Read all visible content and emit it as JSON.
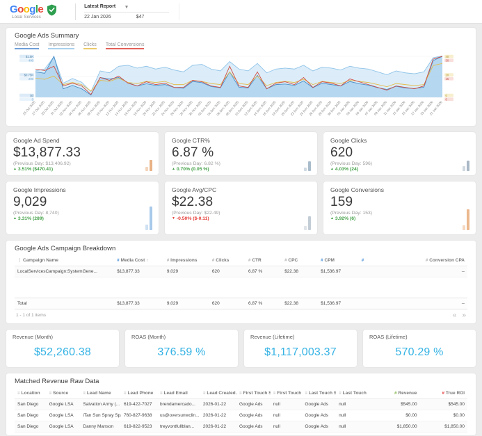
{
  "icons": {
    "caret_down": "▾",
    "check": "✓",
    "sort_up": "↑",
    "sort_down": "↓",
    "hash": "#",
    "menu": "⋮",
    "filter": "≡",
    "prev": "«",
    "next": "»",
    "up": "▲",
    "down": "▼"
  },
  "colors": {
    "accent_cyan": "#35b3e4",
    "green": "#43a047",
    "red": "#e53935"
  },
  "header": {
    "logo_letters": [
      {
        "ch": "G",
        "c": "#4285F4"
      },
      {
        "ch": "o",
        "c": "#EA4335"
      },
      {
        "ch": "o",
        "c": "#FBBC05"
      },
      {
        "ch": "g",
        "c": "#4285F4"
      },
      {
        "ch": "l",
        "c": "#34A853"
      },
      {
        "ch": "e",
        "c": "#EA4335"
      }
    ],
    "logo_subtext": "Local Services",
    "report_selector": {
      "label": "Latest Report",
      "date": "22 Jan 2026",
      "value": "$47"
    }
  },
  "ads_summary": {
    "title": "Google Ads Summary",
    "legend": [
      {
        "label": "Media Cost",
        "color": "#6f9fd8"
      },
      {
        "label": "Impressions",
        "color": "#a9d0ee"
      },
      {
        "label": "Clicks",
        "color": "#ecca6a"
      },
      {
        "label": "Total Conversions",
        "color": "#e2625a"
      }
    ]
  },
  "chart_data": {
    "type": "area",
    "x": [
      "25 Oct 2025",
      "27 Oct 2025",
      "29 Oct 2025",
      "31 Oct 2025",
      "02 Nov 2025",
      "04 Nov 2025",
      "06 Nov 2025",
      "08 Nov 2025",
      "10 Nov 2025",
      "12 Nov 2025",
      "14 Nov 2025",
      "16 Nov 2025",
      "18 Nov 2025",
      "20 Nov 2025",
      "22 Nov 2025",
      "24 Nov 2025",
      "26 Nov 2025",
      "28 Nov 2025",
      "30 Nov 2025",
      "02 Dec 2025",
      "04 Dec 2025",
      "06 Dec 2025",
      "08 Dec 2025",
      "10 Dec 2025",
      "12 Dec 2025",
      "14 Dec 2025",
      "16 Dec 2025",
      "18 Dec 2025",
      "20 Dec 2025",
      "22 Dec 2025",
      "24 Dec 2025",
      "26 Dec 2025",
      "28 Dec 2025",
      "30 Dec 2025",
      "01 Jan 2026",
      "03 Jan 2026",
      "05 Jan 2026",
      "07 Jan 2026",
      "09 Jan 2026",
      "11 Jan 2026",
      "13 Jan 2026",
      "15 Jan 2026",
      "17 Jan 2026",
      "19 Jan 2026",
      "21 Jan 2026"
    ],
    "series": [
      {
        "name": "Impressions",
        "color": "#8fc3e8",
        "fill": "#d6eaf8",
        "max": 450,
        "values": [
          280,
          300,
          430,
          150,
          200,
          160,
          60,
          280,
          260,
          330,
          340,
          310,
          330,
          300,
          320,
          290,
          270,
          340,
          350,
          300,
          280,
          380,
          300,
          280,
          360,
          260,
          300,
          310,
          300,
          340,
          280,
          320,
          310,
          290,
          330,
          310,
          300,
          270,
          240,
          280,
          260,
          250,
          270,
          420,
          440
        ]
      },
      {
        "name": "Media Cost",
        "color": "#4a90c9",
        "fill": "#aed2ee",
        "max": 1500,
        "values": [
          900,
          850,
          1450,
          300,
          420,
          300,
          80,
          700,
          650,
          700,
          520,
          400,
          480,
          420,
          450,
          350,
          320,
          560,
          520,
          380,
          340,
          900,
          360,
          330,
          780,
          300,
          450,
          470,
          420,
          580,
          340,
          500,
          450,
          400,
          560,
          480,
          430,
          340,
          280,
          390,
          330,
          310,
          360,
          1300,
          1450
        ]
      },
      {
        "name": "Clicks",
        "color": "#e3bd4f",
        "max": 40,
        "values": [
          18,
          17,
          20,
          12,
          14,
          12,
          6,
          16,
          15,
          18,
          14,
          13,
          15,
          14,
          15,
          12,
          12,
          16,
          15,
          13,
          12,
          24,
          13,
          12,
          20,
          11,
          14,
          15,
          14,
          17,
          12,
          15,
          14,
          13,
          16,
          15,
          14,
          12,
          10,
          13,
          12,
          11,
          12,
          30,
          32
        ]
      },
      {
        "name": "Total Conversions",
        "color": "#cf4f45",
        "max": 30,
        "values": [
          20,
          19,
          22,
          8,
          10,
          8,
          2,
          14,
          12,
          15,
          10,
          8,
          11,
          9,
          10,
          7,
          7,
          12,
          11,
          8,
          7,
          22,
          8,
          7,
          18,
          6,
          10,
          11,
          9,
          14,
          7,
          11,
          10,
          8,
          13,
          11,
          9,
          7,
          5,
          8,
          7,
          6,
          8,
          27,
          29
        ]
      }
    ],
    "axes": {
      "left": [
        {
          "labels": [
            "$1.5K",
            "$0.75K",
            "$0"
          ],
          "color": "#4f81a8",
          "bg": "#dcebf7"
        },
        {
          "labels": [
            "400",
            "200",
            "0"
          ],
          "color": "#6fa6cf",
          "bg": "#e9f3fb"
        }
      ],
      "right": [
        {
          "labels": [
            "40",
            "20",
            "0"
          ],
          "color": "#b0922c",
          "bg": "#f7efce"
        },
        {
          "labels": [
            "30",
            "15",
            "0"
          ],
          "color": "#c0534a",
          "bg": "#f9dfdc"
        }
      ]
    },
    "title": "Google Ads Summary",
    "xlabel": "",
    "ylabel": "",
    "grid": true,
    "legend_position": "top-left"
  },
  "kpi_cards": [
    {
      "title": "Google Ad Spend",
      "value": "$13,877.33",
      "previous": "(Previous Day: $13,406.92)",
      "trend": "up",
      "change": "3.51% ($470.41)",
      "spark_color": "#e9b286",
      "spark": [
        16,
        6
      ]
    },
    {
      "title": "Google CTR%",
      "value": "6.87 %",
      "previous": "(Previous Day: 6.82 %)",
      "trend": "up",
      "change": "0.70% (0.05 %)",
      "spark_color": "#a9bccb",
      "spark": [
        14,
        5
      ]
    },
    {
      "title": "Google Clicks",
      "value": "620",
      "previous": "(Previous Day: 596)",
      "trend": "up",
      "change": "4.03% (24)",
      "spark_color": "#a9b8c6",
      "spark": [
        15,
        7
      ]
    },
    {
      "title": "Google Impressions",
      "value": "9,029",
      "previous": "(Previous Day: 8,740)",
      "trend": "up",
      "change": "3.31% (289)",
      "spark_color": "#a8c9ea",
      "spark": [
        34,
        8
      ]
    },
    {
      "title": "Google Avg/CPC",
      "value": "$22.38",
      "previous": "(Previous Day: $22.49)",
      "trend": "down",
      "change": "-0.50% ($-0.11)",
      "spark_color": "#c3cdd6",
      "spark": [
        20,
        6
      ]
    },
    {
      "title": "Google Conversions",
      "value": "159",
      "previous": "(Previous Day: 153)",
      "trend": "up",
      "change": "3.92% (6)",
      "spark_color": "#ecb88e",
      "spark": [
        30,
        7
      ]
    }
  ],
  "campaign_breakdown": {
    "title": "Google Ads Campaign Breakdown",
    "columns": [
      {
        "label": "Campaign Name",
        "icon": "menu"
      },
      {
        "label": "Media Cost",
        "icon": "hash",
        "icon_color": "#4a90d9",
        "sort": "up"
      },
      {
        "label": "Impressions",
        "icon": "hash"
      },
      {
        "label": "Clicks",
        "icon": "hash"
      },
      {
        "label": "CTR",
        "icon": "hash"
      },
      {
        "label": "CPC",
        "icon": "hash"
      },
      {
        "label": "CPM",
        "icon": "hash",
        "icon_color": "#4a90d9"
      },
      {
        "label": "",
        "icon": "hash",
        "icon_color": "#4a90d9"
      },
      {
        "label": "Conversion CPA",
        "icon": "hash",
        "align": "right"
      }
    ],
    "rows": [
      [
        "LocalServicesCampaign:SystemGene...",
        "$13,877.33",
        "9,029",
        "620",
        "6.87 %",
        "$22.38",
        "$1,536.97",
        "",
        "--"
      ]
    ],
    "total_row": [
      "Total",
      "$13,877.33",
      "9,029",
      "620",
      "6.87 %",
      "$22.38",
      "$1,536.97",
      "",
      "--"
    ],
    "pagination": "1 - 1 of 1 items"
  },
  "revenue_cards": [
    {
      "title": "Revenue (Month)",
      "value": "$52,260.38"
    },
    {
      "title": "ROAS (Month)",
      "value": "376.59 %"
    },
    {
      "title": "Revenue (Lifetime)",
      "value": "$1,117,003.37"
    },
    {
      "title": "ROAS (Lifetime)",
      "value": "570.29 %"
    }
  ],
  "matched_revenue": {
    "title": "Matched Revenue Raw Data",
    "columns": [
      {
        "label": "Location",
        "icon": "filter"
      },
      {
        "label": "Source",
        "icon": "filter"
      },
      {
        "label": "Lead Name",
        "icon": "filter"
      },
      {
        "label": "Lead Phone",
        "icon": "filter"
      },
      {
        "label": "Lead Email",
        "icon": "filter"
      },
      {
        "label": "Lead Created...",
        "icon": "filter",
        "sort": "down"
      },
      {
        "label": "First Touch So...",
        "icon": "filter"
      },
      {
        "label": "First Touch Ke...",
        "icon": "filter"
      },
      {
        "label": "Last Touch Sou...",
        "icon": "filter"
      },
      {
        "label": "Last Touch Key...",
        "icon": "filter"
      },
      {
        "label": "Revenue",
        "icon": "hash",
        "icon_color": "#7cb342",
        "align": "right"
      },
      {
        "label": "True ROI",
        "icon": "hash",
        "icon_color": "#e53935",
        "align": "right"
      }
    ],
    "rows": [
      [
        "San Diego",
        "Google LSA",
        "Salvation Army (...",
        "619-422-7027",
        "brendamercado...",
        "2026-01-22",
        "Google Ads",
        "null",
        "Google Ads",
        "null",
        "$545.00",
        "$545.00"
      ],
      [
        "San Diego",
        "Google LSA",
        "iTan Sun Spray Spa",
        "760-827-9638",
        "us@oversunwclin...",
        "2026-01-22",
        "Google Ads",
        "null",
        "Google Ads",
        "null",
        "$0.00",
        "$0.00"
      ],
      [
        "San Diego",
        "Google LSA",
        "Danny Manson",
        "619-822-9523",
        "treyvontfullblan...",
        "2026-01-22",
        "Google Ads",
        "null",
        "Google Ads",
        "null",
        "$1,850.00",
        "$1,850.00"
      ]
    ]
  }
}
